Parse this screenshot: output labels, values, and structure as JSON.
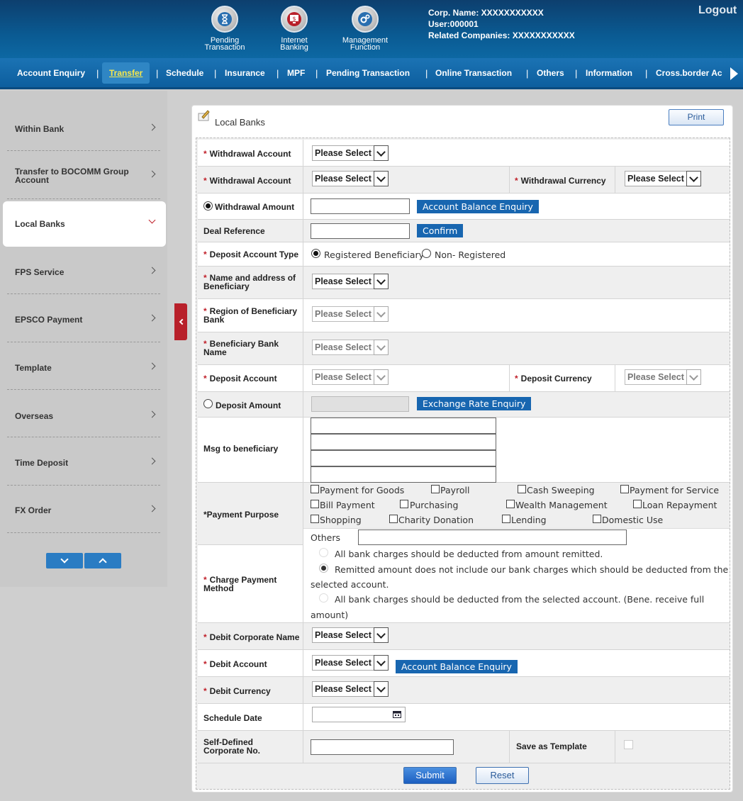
{
  "header": {
    "icons": [
      {
        "label_line1": "Pending",
        "label_line2": "Transaction",
        "icon": "hourglass-icon"
      },
      {
        "label_line1": "Internet",
        "label_line2": "Banking",
        "icon": "monitor-dollar-icon"
      },
      {
        "label_line1": "Management",
        "label_line2": "Function",
        "icon": "gears-icon"
      }
    ],
    "corp_name": "Corp. Name: XXXXXXXXXXX",
    "user": "User:000001",
    "related": "Related Companies: XXXXXXXXXXX",
    "logout": "Logout"
  },
  "nav": {
    "items": [
      "Account Enquiry",
      "Transfer",
      "Schedule",
      "Insurance",
      "MPF",
      "Pending Transaction",
      "Online Transaction",
      "Others",
      "Information",
      "Cross.border Ac"
    ],
    "separator": "|",
    "active": "Transfer"
  },
  "sidebar": {
    "items": [
      {
        "label": "Within Bank"
      },
      {
        "label": "Transfer to BOCOMM Group Account"
      },
      {
        "label": "Local Banks",
        "active": true
      },
      {
        "label": "FPS Service"
      },
      {
        "label": "EPSCO Payment"
      },
      {
        "label": "Template"
      },
      {
        "label": "Overseas"
      },
      {
        "label": "Time Deposit"
      },
      {
        "label": "FX Order"
      }
    ]
  },
  "panel": {
    "title": "Local Banks",
    "print": "Print"
  },
  "form": {
    "required_mark": "*",
    "select_placeholder": "Please Select",
    "withdrawal_account_1": "Withdrawal Account",
    "withdrawal_account_2": "Withdrawal Account",
    "withdrawal_currency": "Withdrawal Currency",
    "withdrawal_amount": "Withdrawal Amount",
    "account_balance_enquiry": "Account Balance Enquiry",
    "deal_reference": "Deal Reference",
    "confirm": "Confirm",
    "deposit_account_type": "Deposit Account Type",
    "registered_beneficiary": "Registered Beneficiary",
    "non_registered": "Non- Registered",
    "name_address_beneficiary": "Name and address of Beneficiary",
    "region_beneficiary_bank": "Region of Beneficiary Bank",
    "beneficiary_bank_name": "Beneficiary Bank Name",
    "deposit_account": "Deposit Account",
    "deposit_currency": "Deposit Currency",
    "deposit_amount": "Deposit Amount",
    "exchange_rate_enquiry": "Exchange Rate Enquiry",
    "msg_to_beneficiary": "Msg to beneficiary",
    "payment_purpose": "Payment Purpose",
    "purposes": [
      "Payment for Goods",
      "Payroll",
      "Cash Sweeping",
      "Payment for Service",
      "Bill Payment",
      "Purchasing",
      "Wealth Management",
      "Loan Repayment",
      "Shopping",
      "Charity Donation",
      "Lending",
      "Domestic Use"
    ],
    "others": "Others",
    "charge_payment_method": "Charge Payment Method",
    "charge_opt1": "All bank charges should be deducted from amount remitted.",
    "charge_opt2a": "Remitted amount does not include our bank charges which should be deducted from the",
    "charge_opt2b": "selected account.",
    "charge_opt3a": "All bank charges should be deducted from the selected account. (Bene. receive full",
    "charge_opt3b": "amount)",
    "debit_corporate_name": "Debit Corporate Name",
    "debit_account": "Debit Account",
    "debit_currency": "Debit Currency",
    "schedule_date": "Schedule Date",
    "self_defined_corp_no": "Self-Defined Corporate No.",
    "save_as_template": "Save as Template",
    "submit": "Submit",
    "reset": "Reset"
  }
}
